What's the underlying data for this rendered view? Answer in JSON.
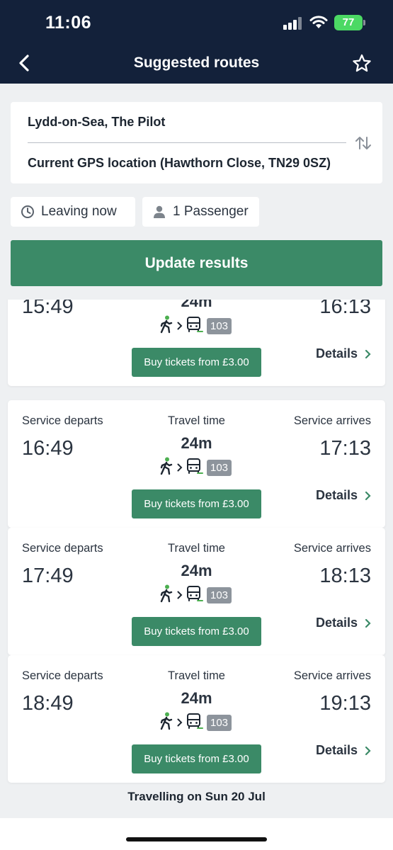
{
  "status_bar": {
    "time": "11:06",
    "battery": "77"
  },
  "header": {
    "title": "Suggested routes",
    "back_icon": "chevron-left-icon",
    "favorite_icon": "star-icon"
  },
  "route": {
    "from": "Lydd-on-Sea, The Pilot",
    "to": "Current GPS location (Hawthorn Close, TN29 0SZ)"
  },
  "filters": {
    "leaving": "Leaving now",
    "passengers": "1 Passenger"
  },
  "update_button": "Update results",
  "labels": {
    "departs": "Service departs",
    "travel_time": "Travel time",
    "arrives": "Service arrives",
    "details": "Details"
  },
  "results": [
    {
      "depart": "15:49",
      "arrive": "16:13",
      "duration": "24m",
      "bus": "103",
      "buy": "Buy tickets from £3.00"
    },
    {
      "depart": "16:49",
      "arrive": "17:13",
      "duration": "24m",
      "bus": "103",
      "buy": "Buy tickets from £3.00"
    },
    {
      "depart": "17:49",
      "arrive": "18:13",
      "duration": "24m",
      "bus": "103",
      "buy": "Buy tickets from £3.00"
    },
    {
      "depart": "18:49",
      "arrive": "19:13",
      "duration": "24m",
      "bus": "103",
      "buy": "Buy tickets from £3.00"
    }
  ],
  "footer": {
    "travelling_on": "Travelling on Sun 20 Jul"
  },
  "colors": {
    "header_bg": "#13213a",
    "accent_green": "#3b8a67",
    "page_bg": "#eef0f2",
    "walk_icon_green": "#4caf50"
  }
}
